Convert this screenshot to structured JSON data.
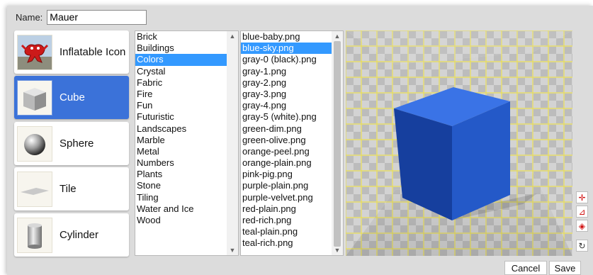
{
  "name_field": {
    "label": "Name:",
    "value": "Mauer"
  },
  "shapes": [
    {
      "label": "Inflatable Icon",
      "icon": "inflatable-icon"
    },
    {
      "label": "Cube",
      "icon": "cube-icon",
      "selected": true
    },
    {
      "label": "Sphere",
      "icon": "sphere-icon"
    },
    {
      "label": "Tile",
      "icon": "tile-icon"
    },
    {
      "label": "Cylinder",
      "icon": "cylinder-icon"
    }
  ],
  "categories": {
    "items": [
      "Brick",
      "Buildings",
      "Colors",
      "Crystal",
      "Fabric",
      "Fire",
      "Fun",
      "Futuristic",
      "Landscapes",
      "Marble",
      "Metal",
      "Numbers",
      "Plants",
      "Stone",
      "Tiling",
      "Water and Ice",
      "Wood"
    ],
    "selected": "Colors"
  },
  "textures": {
    "items": [
      "blue-baby.png",
      "blue-sky.png",
      "gray-0 (black).png",
      "gray-1.png",
      "gray-2.png",
      "gray-3.png",
      "gray-4.png",
      "gray-5 (white).png",
      "green-dim.png",
      "green-olive.png",
      "orange-peel.png",
      "orange-plain.png",
      "pink-pig.png",
      "purple-plain.png",
      "purple-velvet.png",
      "red-plain.png",
      "red-rich.png",
      "teal-plain.png",
      "teal-rich.png"
    ],
    "selected": "blue-sky.png"
  },
  "tools": [
    {
      "icon": "move-icon",
      "glyph": "✛",
      "color": "#d01010"
    },
    {
      "icon": "snap-icon",
      "glyph": "⊿",
      "color": "#d01010"
    },
    {
      "icon": "rotate-3d-icon",
      "glyph": "◈",
      "color": "#d01010"
    },
    {
      "icon": "reset-icon",
      "glyph": "↻",
      "color": "#333333"
    }
  ],
  "buttons": {
    "cancel": "Cancel",
    "save": "Save"
  },
  "colors": {
    "dialog_bg": "#dcdcdc",
    "selected_shape": "#3b72d9",
    "selected_list": "#3399ff",
    "cube": "#2b5fd1",
    "grid_line": "#e8dd55"
  }
}
